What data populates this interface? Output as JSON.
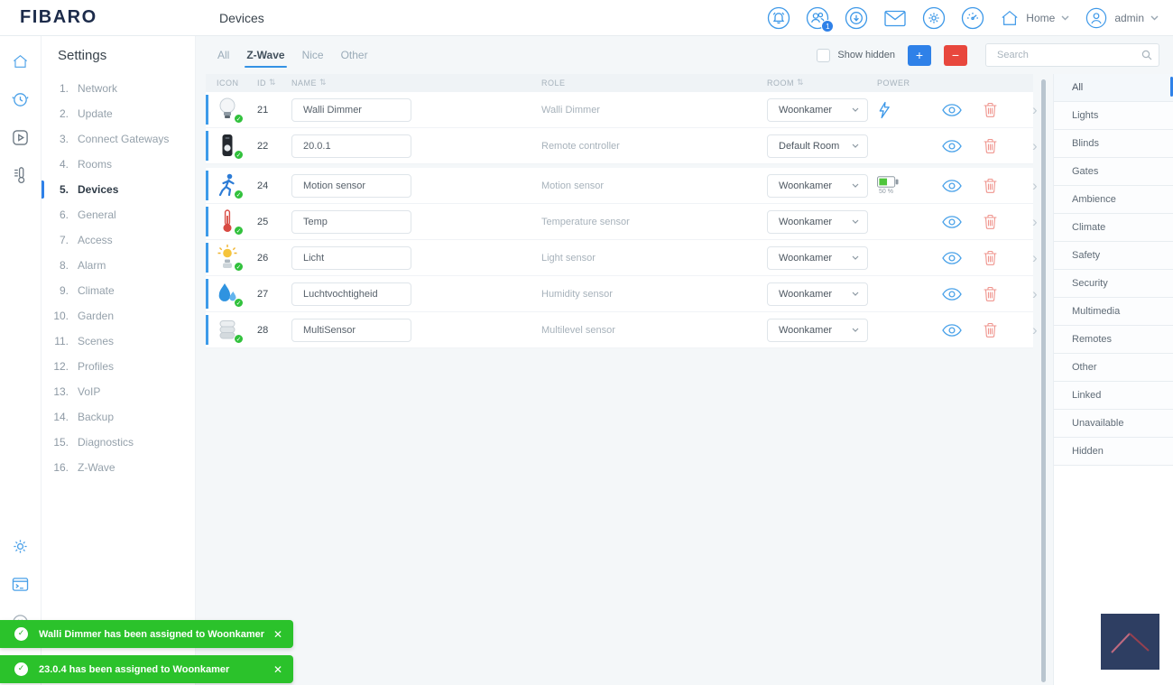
{
  "colors": {
    "accent": "#3392e4",
    "brand_navy": "#1c2b4a",
    "add_blue": "#2f81e8",
    "remove_red": "#e8473d",
    "toast_green": "#2bc22b",
    "row_accent": "#3d9be9"
  },
  "brand": {
    "logo": "FIBARO"
  },
  "header": {
    "title": "Devices",
    "notifications_badge": "1",
    "home_label": "Home",
    "user_label": "admin",
    "icons": [
      "alarm-bell",
      "users",
      "download",
      "mail",
      "settings-gear",
      "gauge",
      "home",
      "user-avatar"
    ]
  },
  "rail_icons": [
    "home",
    "clock",
    "play",
    "thermostat",
    "gear",
    "terminal",
    "pause-circle"
  ],
  "sidebar": {
    "title": "Settings",
    "items": [
      {
        "num": "1.",
        "label": "Network"
      },
      {
        "num": "2.",
        "label": "Update"
      },
      {
        "num": "3.",
        "label": "Connect Gateways"
      },
      {
        "num": "4.",
        "label": "Rooms"
      },
      {
        "num": "5.",
        "label": "Devices",
        "active": true
      },
      {
        "num": "6.",
        "label": "General"
      },
      {
        "num": "7.",
        "label": "Access"
      },
      {
        "num": "8.",
        "label": "Alarm"
      },
      {
        "num": "9.",
        "label": "Climate"
      },
      {
        "num": "10.",
        "label": "Garden"
      },
      {
        "num": "11.",
        "label": "Scenes"
      },
      {
        "num": "12.",
        "label": "Profiles"
      },
      {
        "num": "13.",
        "label": "VoIP"
      },
      {
        "num": "14.",
        "label": "Backup"
      },
      {
        "num": "15.",
        "label": "Diagnostics"
      },
      {
        "num": "16.",
        "label": "Z-Wave"
      }
    ]
  },
  "tabs": [
    {
      "label": "All"
    },
    {
      "label": "Z-Wave",
      "active": true
    },
    {
      "label": "Nice"
    },
    {
      "label": "Other"
    }
  ],
  "toolbar": {
    "show_hidden_label": "Show hidden",
    "show_hidden_checked": false,
    "add_label": "+",
    "remove_label": "−",
    "search_placeholder": "Search",
    "search_value": ""
  },
  "table": {
    "columns": [
      {
        "label": "ICON",
        "sortable": false
      },
      {
        "label": "ID",
        "sortable": true
      },
      {
        "label": "NAME",
        "sortable": true
      },
      {
        "label": "ROLE",
        "sortable": false
      },
      {
        "label": "ROOM",
        "sortable": true
      },
      {
        "label": "POWER",
        "sortable": false
      }
    ],
    "rows": [
      {
        "icon": "dimmer-bulb",
        "id": "21",
        "name": "Walli Dimmer",
        "role": "Walli Dimmer",
        "room": "Woonkamer",
        "power": "mains"
      },
      {
        "icon": "remote-controller",
        "id": "22",
        "name": "20.0.1",
        "role": "Remote controller",
        "room": "Default Room",
        "power": "none"
      },
      {
        "icon": "motion-sensor",
        "id": "24",
        "name": "Motion sensor",
        "role": "Motion sensor",
        "room": "Woonkamer",
        "power": "battery",
        "battery_level": "50 %",
        "group_break": true
      },
      {
        "icon": "temperature-sensor",
        "id": "25",
        "name": "Temp",
        "role": "Temperature sensor",
        "room": "Woonkamer",
        "power": "none"
      },
      {
        "icon": "light-sensor",
        "id": "26",
        "name": "Licht",
        "role": "Light sensor",
        "room": "Woonkamer",
        "power": "none"
      },
      {
        "icon": "humidity-sensor",
        "id": "27",
        "name": "Luchtvochtigheid",
        "role": "Humidity sensor",
        "room": "Woonkamer",
        "power": "none"
      },
      {
        "icon": "multilevel-sensor",
        "id": "28",
        "name": "MultiSensor",
        "role": "Multilevel sensor",
        "room": "Woonkamer",
        "power": "none"
      }
    ]
  },
  "categories": [
    {
      "label": "All",
      "active": true
    },
    {
      "label": "Lights"
    },
    {
      "label": "Blinds"
    },
    {
      "label": "Gates"
    },
    {
      "label": "Ambience"
    },
    {
      "label": "Climate"
    },
    {
      "label": "Safety"
    },
    {
      "label": "Security"
    },
    {
      "label": "Multimedia"
    },
    {
      "label": "Remotes"
    },
    {
      "label": "Other"
    },
    {
      "label": "Linked"
    },
    {
      "label": "Unavailable"
    },
    {
      "label": "Hidden"
    }
  ],
  "toasts": [
    {
      "message": "Walli Dimmer has been assigned to Woonkamer"
    },
    {
      "message": "23.0.4 has been assigned to Woonkamer"
    }
  ]
}
